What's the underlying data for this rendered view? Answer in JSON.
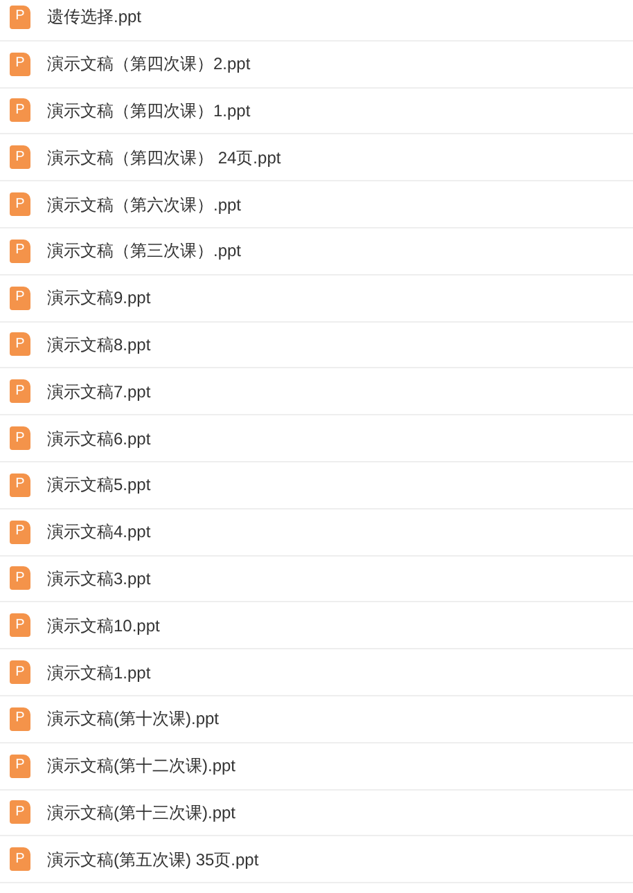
{
  "files": [
    {
      "icon_letter": "P",
      "name": "遗传选择.ppt"
    },
    {
      "icon_letter": "P",
      "name": "演示文稿（第四次课）2.ppt"
    },
    {
      "icon_letter": "P",
      "name": "演示文稿（第四次课）1.ppt"
    },
    {
      "icon_letter": "P",
      "name": "演示文稿（第四次课） 24页.ppt"
    },
    {
      "icon_letter": "P",
      "name": "演示文稿（第六次课）.ppt"
    },
    {
      "icon_letter": "P",
      "name": "演示文稿（第三次课）.ppt"
    },
    {
      "icon_letter": "P",
      "name": "演示文稿9.ppt"
    },
    {
      "icon_letter": "P",
      "name": "演示文稿8.ppt"
    },
    {
      "icon_letter": "P",
      "name": "演示文稿7.ppt"
    },
    {
      "icon_letter": "P",
      "name": "演示文稿6.ppt"
    },
    {
      "icon_letter": "P",
      "name": "演示文稿5.ppt"
    },
    {
      "icon_letter": "P",
      "name": "演示文稿4.ppt"
    },
    {
      "icon_letter": "P",
      "name": "演示文稿3.ppt"
    },
    {
      "icon_letter": "P",
      "name": "演示文稿10.ppt"
    },
    {
      "icon_letter": "P",
      "name": "演示文稿1.ppt"
    },
    {
      "icon_letter": "P",
      "name": "演示文稿(第十次课).ppt"
    },
    {
      "icon_letter": "P",
      "name": "演示文稿(第十二次课).ppt"
    },
    {
      "icon_letter": "P",
      "name": "演示文稿(第十三次课).ppt"
    },
    {
      "icon_letter": "P",
      "name": "演示文稿(第五次课) 35页.ppt"
    }
  ]
}
